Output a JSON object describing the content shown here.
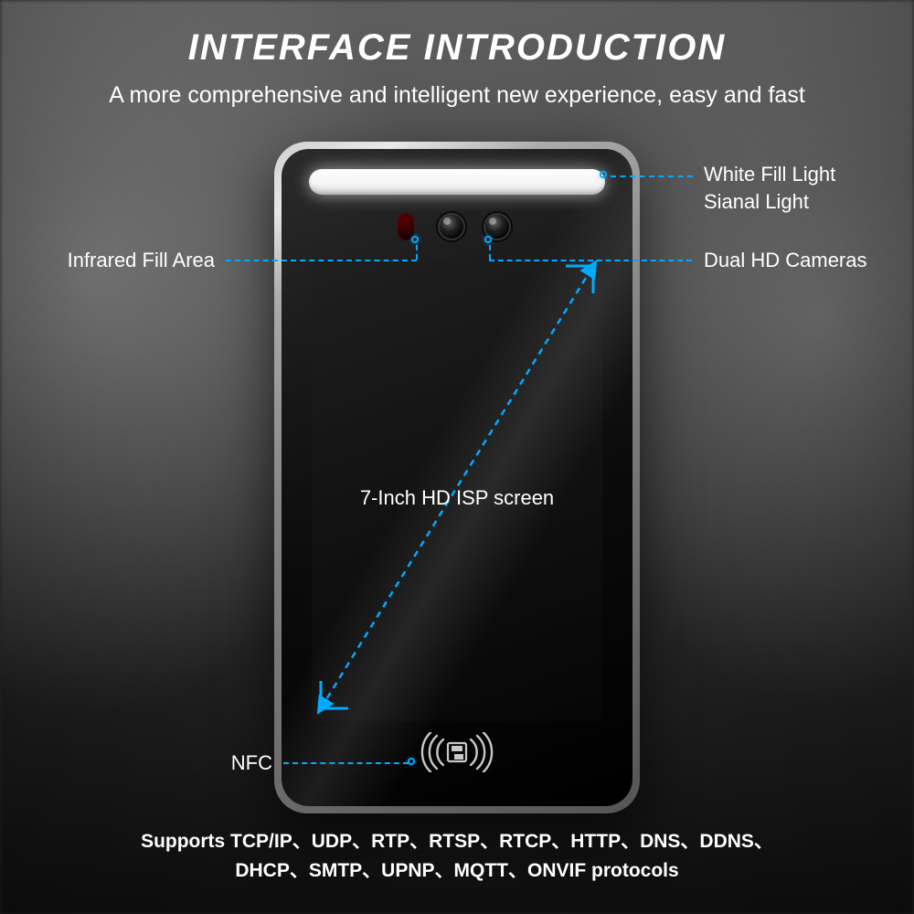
{
  "title": "INTERFACE INTRODUCTION",
  "subtitle": "A more comprehensive and intelligent new experience, easy and fast",
  "callouts": {
    "white_light_1": "White Fill Light",
    "white_light_2": "Sianal Light",
    "dual_cameras": "Dual HD Cameras",
    "infrared": "Infrared Fill Area",
    "screen": "7-Inch HD ISP screen",
    "nfc": "NFC"
  },
  "footer_line1": "Supports TCP/IP、UDP、RTP、RTSP、RTCP、HTTP、DNS、DDNS、",
  "footer_line2": "DHCP、SMTP、UPNP、MQTT、ONVIF protocols",
  "colors": {
    "accent": "#00aaff"
  }
}
